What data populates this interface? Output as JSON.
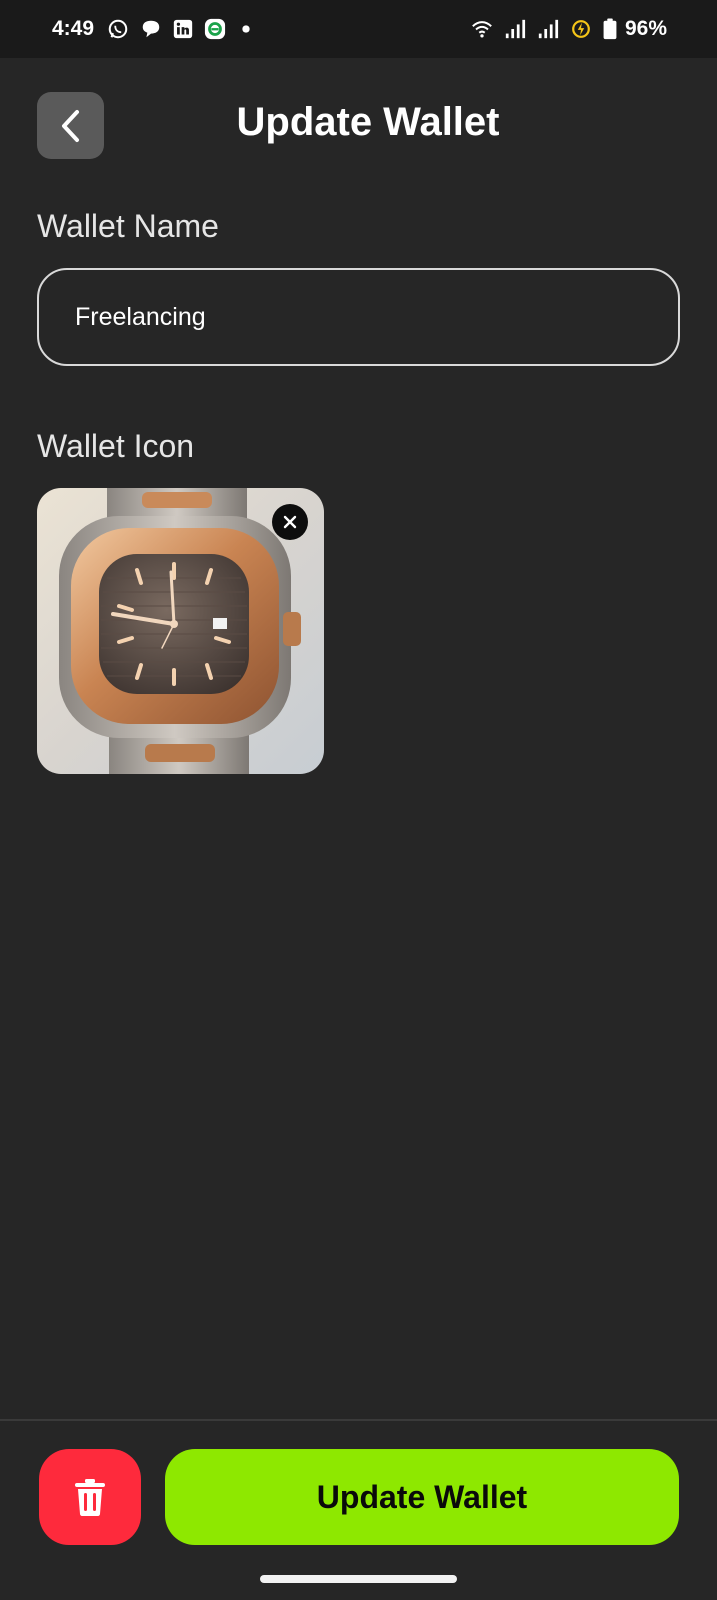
{
  "status_bar": {
    "time": "4:49",
    "battery_percent": "96%",
    "notification_icons": [
      "whatsapp-icon",
      "messages-icon",
      "linkedin-icon",
      "app-icon",
      "dot-icon"
    ],
    "system_icons": [
      "wifi-icon",
      "signal-icon",
      "signal-icon",
      "battery-saver-icon",
      "battery-icon"
    ]
  },
  "header": {
    "title": "Update Wallet",
    "back_icon": "chevron-left-icon"
  },
  "form": {
    "name_label": "Wallet Name",
    "name_value": "Freelancing",
    "icon_label": "Wallet Icon",
    "icon_image": "wallet-icon-image",
    "remove_icon": "close-icon"
  },
  "footer": {
    "delete_icon": "trash-icon",
    "update_label": "Update Wallet"
  },
  "colors": {
    "background": "#262626",
    "accent_green": "#8ee800",
    "delete_red": "#fe2a3c"
  }
}
